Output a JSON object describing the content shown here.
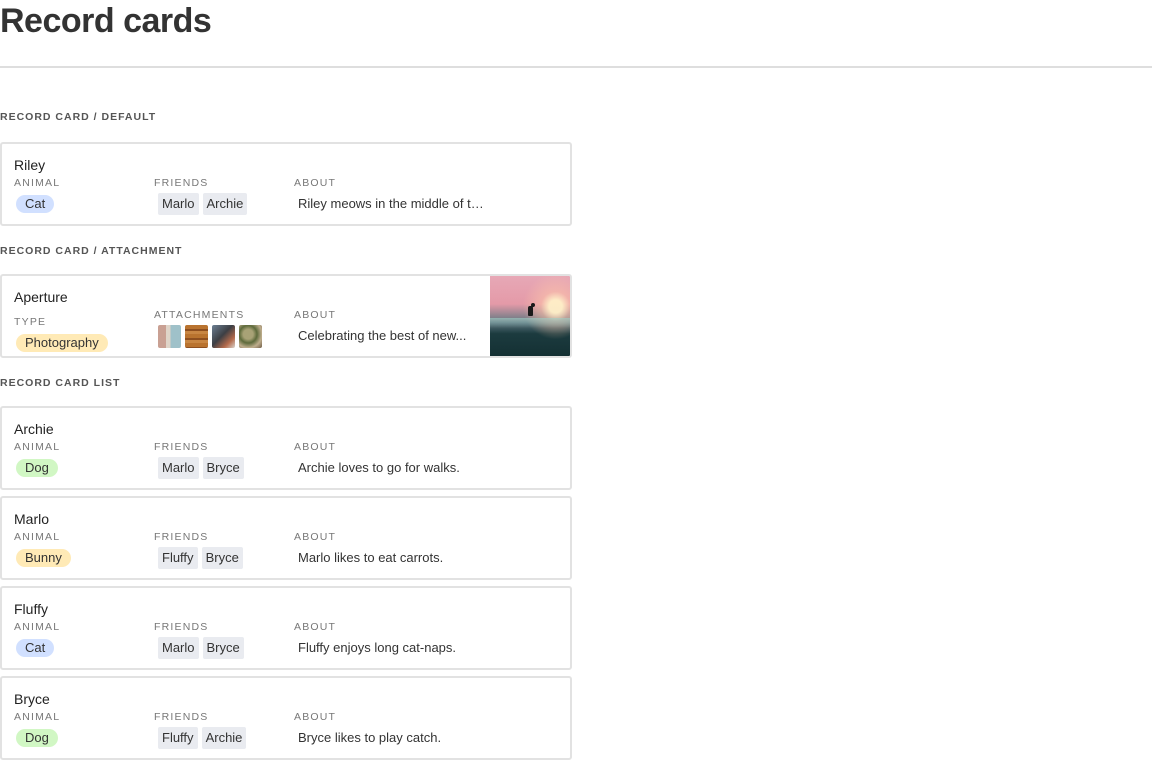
{
  "page": {
    "title": "Record cards"
  },
  "colors": {
    "cat": "#d1e0ff",
    "dog": "#d1f7c4",
    "bunny": "#ffeab6",
    "photography": "#ffeab6",
    "tag_bg": "#e9ebf0",
    "card_border": "#e2e2e2"
  },
  "sections": {
    "default": "RECORD CARD / DEFAULT",
    "attachment": "RECORD CARD / ATTACHMENT",
    "list": "RECORD CARD LIST"
  },
  "default_card": {
    "name": "Riley",
    "animal_label": "ANIMAL",
    "animal": "Cat",
    "friends_label": "FRIENDS",
    "friends": [
      "Marlo",
      "Archie"
    ],
    "about_label": "ABOUT",
    "about": "Riley meows in the middle of the night."
  },
  "attachment_card": {
    "name": "Aperture",
    "type_label": "TYPE",
    "type": "Photography",
    "attachments_label": "ATTACHMENTS",
    "attachments": [
      "attachment-thumbnail",
      "attachment-thumbnail",
      "attachment-thumbnail",
      "attachment-thumbnail"
    ],
    "about_label": "ABOUT",
    "about": "Celebrating the best of new..."
  },
  "list_cards": [
    {
      "name": "Archie",
      "animal_label": "ANIMAL",
      "animal": "Dog",
      "friends_label": "FRIENDS",
      "friends": [
        "Marlo",
        "Bryce"
      ],
      "about_label": "ABOUT",
      "about": "Archie loves to go for walks."
    },
    {
      "name": "Marlo",
      "animal_label": "ANIMAL",
      "animal": "Bunny",
      "friends_label": "FRIENDS",
      "friends": [
        "Fluffy",
        "Bryce"
      ],
      "about_label": "ABOUT",
      "about": "Marlo likes to eat carrots."
    },
    {
      "name": "Fluffy",
      "animal_label": "ANIMAL",
      "animal": "Cat",
      "friends_label": "FRIENDS",
      "friends": [
        "Marlo",
        "Bryce"
      ],
      "about_label": "ABOUT",
      "about": "Fluffy enjoys long cat-naps."
    },
    {
      "name": "Bryce",
      "animal_label": "ANIMAL",
      "animal": "Dog",
      "friends_label": "FRIENDS",
      "friends": [
        "Fluffy",
        "Archie"
      ],
      "about_label": "ABOUT",
      "about": "Bryce likes to play catch."
    }
  ]
}
